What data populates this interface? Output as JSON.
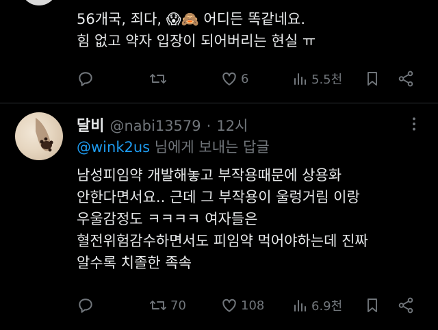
{
  "tweet1": {
    "text": "56개국, 죄다, 😱🙈 어디든 똑같네요.\n힘 없고 약자 입장이 되어버리는 현실 ㅠ",
    "actions": {
      "reply": "",
      "retweet": "",
      "like": "6",
      "views": "5.5천"
    }
  },
  "tweet2": {
    "display_name": "달비",
    "handle": "@nabi13579",
    "separator": "·",
    "time": "12시",
    "reply_to_handle": "@wink2us",
    "reply_to_suffix": " 님에게 보내는 답글",
    "text": "남성피임약 개발해놓고 부작용때문에 상용화\n안한다면서요.. 근데 그 부작용이 울렁거림 이랑\n우울감정도 ㅋㅋㅋㅋ 여자들은\n혈전위험감수하면서도 피임약 먹어야하는데 진짜\n알수록 치졸한 족속",
    "actions": {
      "reply": "",
      "retweet": "70",
      "like": "108",
      "views": "6.9천"
    }
  },
  "colors": {
    "background": "#000000",
    "text": "#e7e9ea",
    "muted": "#71767b",
    "link": "#1d9bf0",
    "divider": "#2f3336"
  }
}
